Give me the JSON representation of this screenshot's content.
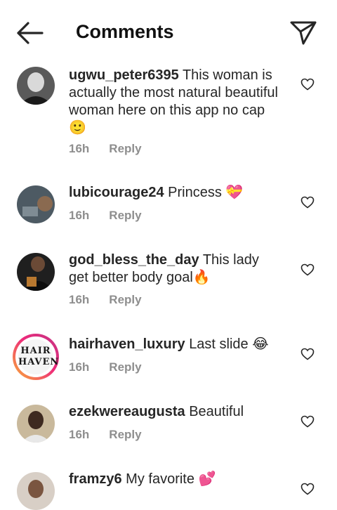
{
  "header": {
    "title": "Comments",
    "back_icon": "arrow-left-icon",
    "send_icon": "paper-plane-icon"
  },
  "comments": [
    {
      "username": "ugwu_peter6395",
      "text": "This woman is actually the most natural beautiful woman here on this app no cap 🙂",
      "time": "16h",
      "reply": "Reply"
    },
    {
      "username": "lubicourage24",
      "text": "Princess 💝",
      "time": "16h",
      "reply": "Reply"
    },
    {
      "username": "god_bless_the_day",
      "text": "This lady get better body goal🔥",
      "time": "16h",
      "reply": "Reply"
    },
    {
      "username": "hairhaven_luxury",
      "text": "Last slide 😂",
      "time": "16h",
      "reply": "Reply",
      "avatar_logo": [
        "HAIR",
        "HAVEN"
      ]
    },
    {
      "username": "ezekwereaugusta",
      "text": "Beautiful",
      "time": "16h",
      "reply": "Reply"
    },
    {
      "username": "framzy6",
      "text": "My favorite 💕",
      "time": "",
      "reply": ""
    }
  ],
  "colors": {
    "text": "#262626",
    "meta": "#8e8e8e",
    "icon": "#262626"
  }
}
